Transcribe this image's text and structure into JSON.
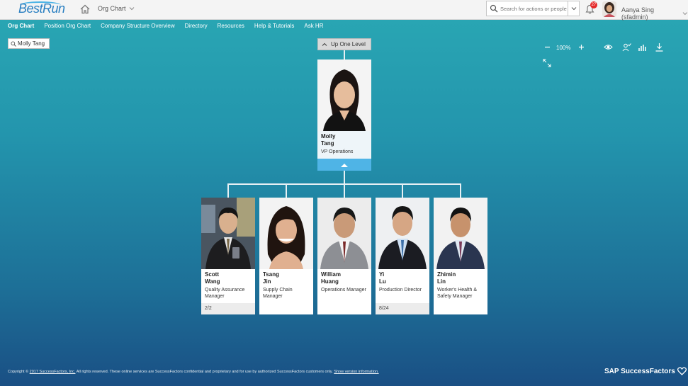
{
  "shell": {
    "logo_text": "BestRun",
    "module": "Org Chart",
    "search_placeholder": "Search for actions or people",
    "notification_count": "27",
    "user_name": "Aanya Sing (sfadmin)"
  },
  "nav": {
    "items": [
      {
        "label": "Org Chart",
        "active": true
      },
      {
        "label": "Position Org Chart"
      },
      {
        "label": "Company Structure Overview"
      },
      {
        "label": "Directory"
      },
      {
        "label": "Resources"
      },
      {
        "label": "Help & Tutorials"
      },
      {
        "label": "Ask HR"
      }
    ]
  },
  "chart_search": {
    "value": "Molly Tang"
  },
  "toolbar": {
    "zoom_level": "100%"
  },
  "up_level": {
    "label": "Up One Level"
  },
  "root": {
    "first": "Molly",
    "last": "Tang",
    "title": "VP Operations"
  },
  "reports": [
    {
      "first": "Scott",
      "last": "Wang",
      "title": "Quality Assurance Manager",
      "count": "2/2"
    },
    {
      "first": "Tsang",
      "last": "Jin",
      "title": "Supply Chain Manager",
      "count": ""
    },
    {
      "first": "William",
      "last": "Huang",
      "title": "Operations Manager",
      "count": ""
    },
    {
      "first": "Yi",
      "last": "Lu",
      "title": "Production Director",
      "count": "8/24"
    },
    {
      "first": "Zhimin",
      "last": "Lin",
      "title": "Worker's Health & Safety Manager",
      "count": ""
    }
  ],
  "footer": {
    "prefix": "Copyright © ",
    "copyright_link": "2017 SuccessFactors, Inc.",
    "text": " All rights reserved. These online services are SuccessFactors confidential and proprietary and for use by authorized SuccessFactors customers only. ",
    "version_link": "Show version information.",
    "brand": "SAP SuccessFactors"
  },
  "colors": {
    "accent": "#4fb4e6",
    "badge": "#e52a2a"
  }
}
